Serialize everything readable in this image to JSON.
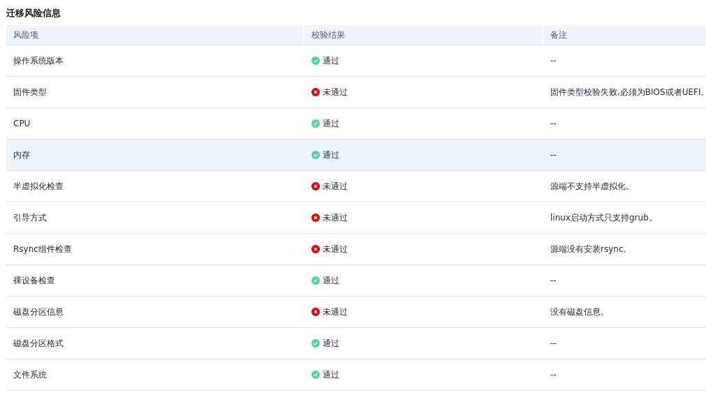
{
  "title": "迁移风险信息",
  "table": {
    "columns": [
      "风险项",
      "校验结果",
      "备注"
    ],
    "rows": [
      {
        "item": "操作系统版本",
        "result": {
          "kind": "pass",
          "text": "通过"
        },
        "note": "--",
        "highlighted": false
      },
      {
        "item": "固件类型",
        "result": {
          "kind": "fail",
          "text": "未通过"
        },
        "note": "固件类型校验失败,必须为BIOS或者UEFI。",
        "highlighted": false
      },
      {
        "item": "CPU",
        "result": {
          "kind": "pass",
          "text": "通过"
        },
        "note": "--",
        "highlighted": false
      },
      {
        "item": "内存",
        "result": {
          "kind": "pass",
          "text": "通过"
        },
        "note": "--",
        "highlighted": true
      },
      {
        "item": "半虚拟化检查",
        "result": {
          "kind": "fail",
          "text": "未通过"
        },
        "note": "源端不支持半虚拟化。",
        "highlighted": false
      },
      {
        "item": "引导方式",
        "result": {
          "kind": "fail",
          "text": "未通过"
        },
        "note": "linux启动方式只支持grub。",
        "highlighted": false
      },
      {
        "item": "Rsync组件检查",
        "result": {
          "kind": "fail",
          "text": "未通过"
        },
        "note": "源端没有安装rsync。",
        "highlighted": false
      },
      {
        "item": "裸设备检查",
        "result": {
          "kind": "pass",
          "text": "通过"
        },
        "note": "--",
        "highlighted": false
      },
      {
        "item": "磁盘分区信息",
        "result": {
          "kind": "fail",
          "text": "未通过"
        },
        "note": "没有磁盘信息。",
        "highlighted": false
      },
      {
        "item": "磁盘分区格式",
        "result": {
          "kind": "pass",
          "text": "通过"
        },
        "note": "--",
        "highlighted": false
      },
      {
        "item": "文件系统",
        "result": {
          "kind": "pass",
          "text": "通过"
        },
        "note": "--",
        "highlighted": false
      }
    ]
  }
}
